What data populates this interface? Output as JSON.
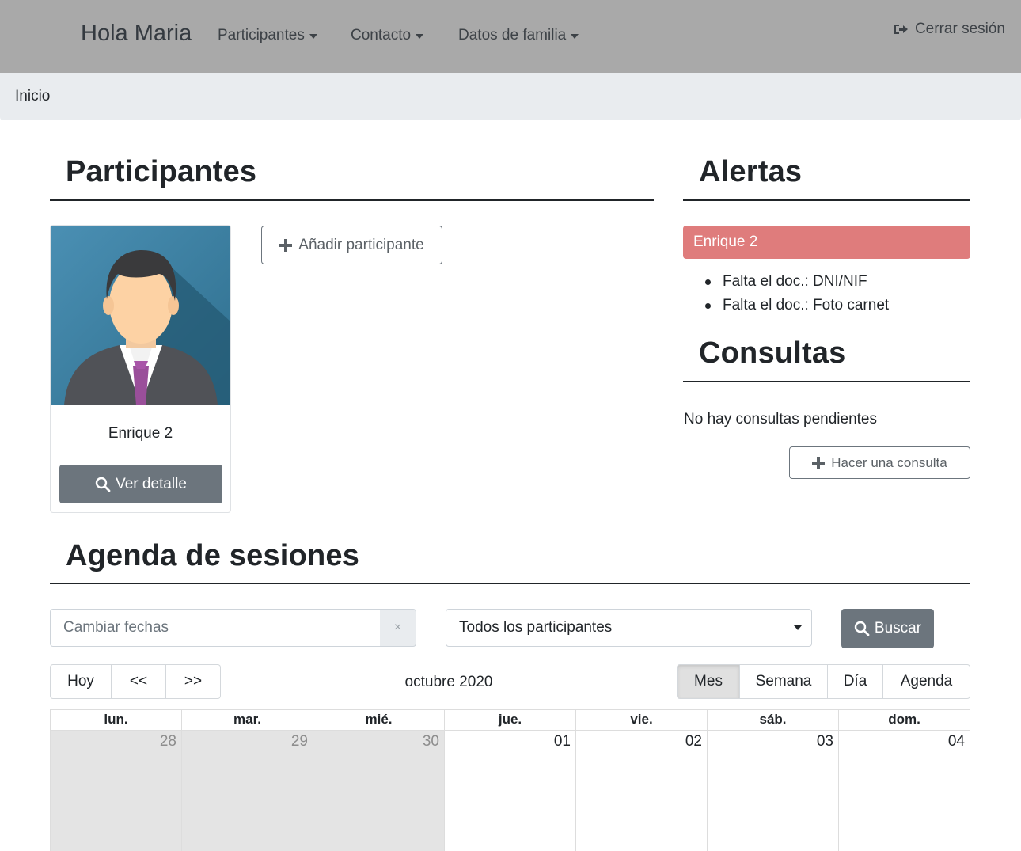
{
  "navbar": {
    "brand": "Hola Maria",
    "menus": [
      {
        "label": "Participantes"
      },
      {
        "label": "Contacto"
      },
      {
        "label": "Datos de familia"
      }
    ],
    "logout_label": "Cerrar sesión"
  },
  "breadcrumb": {
    "current": "Inicio"
  },
  "participants": {
    "title": "Participantes",
    "cards": [
      {
        "name": "Enrique 2",
        "detail_label": "Ver detalle"
      }
    ],
    "add_label": "Añadir participante"
  },
  "alerts": {
    "title": "Alertas",
    "items": [
      {
        "participant": "Enrique 2",
        "messages": [
          "Falta el doc.: DNI/NIF",
          "Falta el doc.: Foto carnet"
        ]
      }
    ]
  },
  "consultas": {
    "title": "Consultas",
    "empty_text": "No hay consultas pendientes",
    "new_label": "Hacer una consulta"
  },
  "agenda": {
    "title": "Agenda de sesiones",
    "date_placeholder": "Cambiar fechas",
    "clear_label": "×",
    "participant_select": "Todos los participantes",
    "search_label": "Buscar",
    "nav_buttons": [
      "Hoy",
      "<<",
      ">>"
    ],
    "period_title": "octubre 2020",
    "view_buttons": [
      "Mes",
      "Semana",
      "Día",
      "Agenda"
    ],
    "active_view": "Mes",
    "weekdays": [
      "lun.",
      "mar.",
      "mié.",
      "jue.",
      "vie.",
      "sáb.",
      "dom."
    ],
    "first_week": [
      "28",
      "29",
      "30",
      "01",
      "02",
      "03",
      "04"
    ]
  },
  "colors": {
    "navbar_bg": "#a9a9a9",
    "alert_bg": "#df7c7c",
    "secondary": "#6c757d",
    "breadcrumb_bg": "#e9ecef"
  }
}
